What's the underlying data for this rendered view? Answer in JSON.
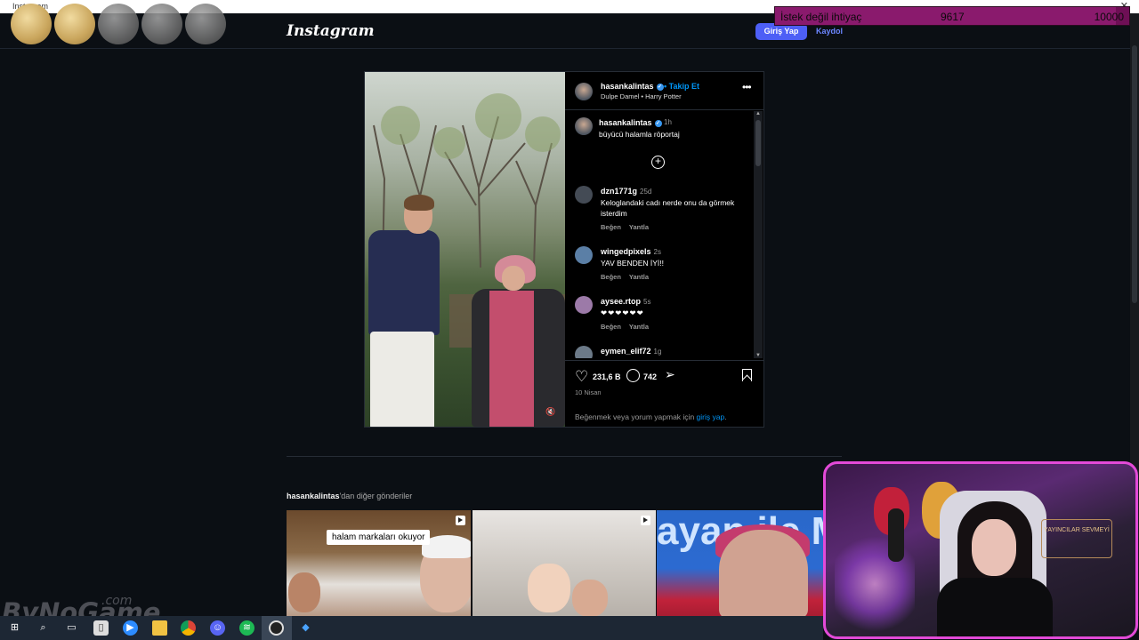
{
  "window": {
    "title": "Instagram",
    "close_glyph": "✕"
  },
  "donation": {
    "label": "İstek değil ihtiyaç",
    "current": "9617",
    "goal": "10000",
    "progress": 0.9617
  },
  "header": {
    "logo": "Instagram",
    "login_label": "Giriş Yap",
    "signup_label": "Kaydol"
  },
  "post": {
    "username": "hasankalintas",
    "follow_label": "• Takip Et",
    "music": "Dulpe Damel • Harry Potter",
    "more_icon": "more-horizontal-icon",
    "caption": {
      "time": "1h",
      "text": "büyücü halamla röportaj"
    },
    "comments": [
      {
        "user": "dzn1771g",
        "time": "25d",
        "text": "Keloglandaki cadı nerde onu da görmek isterdim",
        "like": "Beğen",
        "reply": "Yantla"
      },
      {
        "user": "wingedpixels",
        "time": "2s",
        "text": "YAV BENDEN İYİ!!",
        "like": "Beğen",
        "reply": "Yantla"
      },
      {
        "user": "aysee.rtop",
        "time": "5s",
        "text": "❤❤❤❤❤❤",
        "like": "Beğen",
        "reply": "Yantla"
      },
      {
        "user": "eymen_elif72",
        "time": "1g",
        "text": "",
        "like": "",
        "reply": ""
      }
    ],
    "likes": "231,6 B",
    "comment_count": "742",
    "date": "10 Nisan",
    "login_prompt": "Beğenmek veya yorum yapmak için",
    "login_link": "giriş yap",
    "login_suffix": "."
  },
  "more_posts": {
    "username": "hasankalintas",
    "suffix": "'dan diğer gönderiler",
    "items": [
      {
        "caption": "halam markaları okuyor"
      },
      {
        "caption": ""
      },
      {
        "caption": ""
      }
    ],
    "third_thumb_word": "ayan ile Masada"
  },
  "webcam": {
    "sign_text": "YAYINCILAR SEVMEYİ"
  },
  "watermark": {
    "text": "ByNoGame",
    "suffix": ".com"
  },
  "colors": {
    "accent": "#4d5ff6",
    "link": "#0095f6",
    "webcam_border": "#e34ad8",
    "donation_bg": "#6e0f55"
  }
}
